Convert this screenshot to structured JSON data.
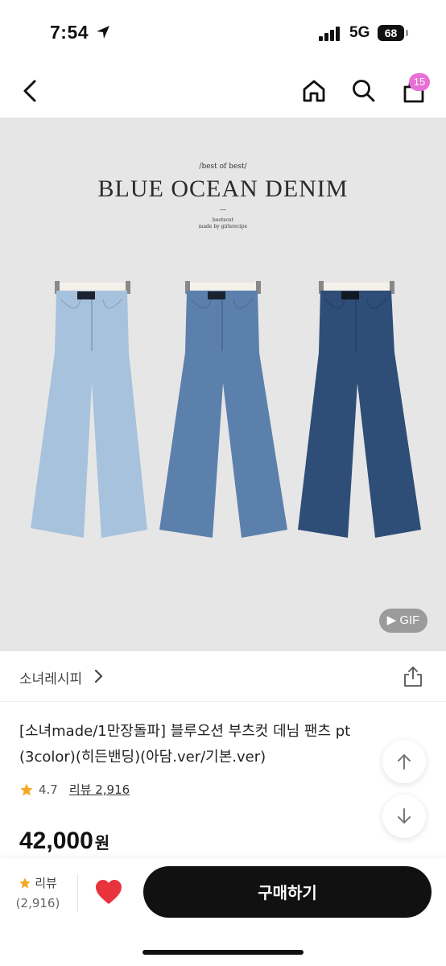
{
  "status_bar": {
    "time": "7:54",
    "network": "5G",
    "battery": "68"
  },
  "nav": {
    "cart_count": "15",
    "icons": [
      "back-arrow-icon",
      "home-icon",
      "search-icon",
      "cart-icon"
    ]
  },
  "hero": {
    "small_top": "/best of best/",
    "title": "BLUE OCEAN DENIM",
    "dash": "—",
    "sub_line1": "bootscut",
    "sub_line2": "made by girlsrecipe",
    "gif_label": "GIF",
    "jean_colors": [
      "#a7c2dc",
      "#5c80ac",
      "#2e4e77"
    ]
  },
  "shop": {
    "name": "소녀레시피"
  },
  "product": {
    "title": "[소녀made/1만장돌파] 블루오션 부츠컷 데님 팬츠 pt (3color)(히든밴딩)(아담.ver/기본.ver)",
    "rating": "4.7",
    "review_link": "리뷰 2,916",
    "price": "42,000",
    "currency": "원"
  },
  "bottom": {
    "review_label": "리뷰",
    "review_count": "(2,916)",
    "buy_label": "구매하기"
  },
  "colors": {
    "accent_badge": "#e86fd6",
    "heart": "#e8333c",
    "star": "#f5a623",
    "buy_button": "#111111"
  }
}
